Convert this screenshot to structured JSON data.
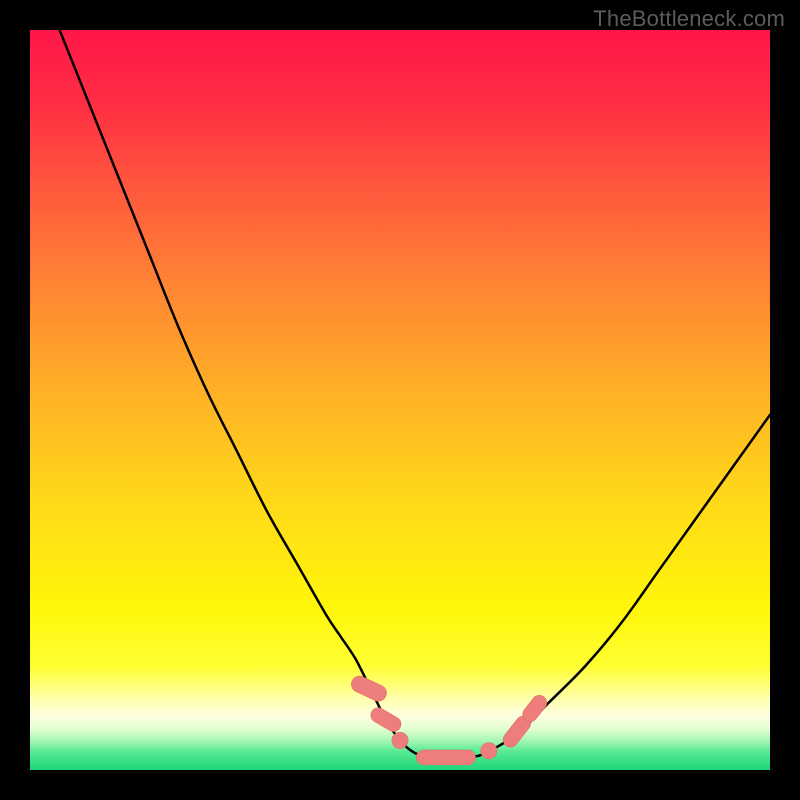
{
  "watermark": {
    "text": "TheBottleneck.com"
  },
  "layout": {
    "outer_w": 800,
    "outer_h": 800,
    "inner_x": 30,
    "inner_y": 30,
    "inner_w": 740,
    "inner_h": 740
  },
  "colors": {
    "frame": "#000000",
    "curve": "#000000",
    "marker_fill": "#ed7e7b",
    "marker_stroke": "#e56a67"
  },
  "gradient_stops": [
    {
      "offset": 0.0,
      "color": "#ff1648"
    },
    {
      "offset": 0.1,
      "color": "#ff2e44"
    },
    {
      "offset": 0.22,
      "color": "#ff5a3c"
    },
    {
      "offset": 0.35,
      "color": "#ff8633"
    },
    {
      "offset": 0.5,
      "color": "#ffb426"
    },
    {
      "offset": 0.65,
      "color": "#ffdc18"
    },
    {
      "offset": 0.78,
      "color": "#fff609"
    },
    {
      "offset": 0.86,
      "color": "#ffff33"
    },
    {
      "offset": 0.905,
      "color": "#ffffb0"
    },
    {
      "offset": 0.928,
      "color": "#fdffe2"
    },
    {
      "offset": 0.945,
      "color": "#e0ffd0"
    },
    {
      "offset": 0.96,
      "color": "#a6f8b4"
    },
    {
      "offset": 0.975,
      "color": "#57e993"
    },
    {
      "offset": 1.0,
      "color": "#1fd779"
    }
  ],
  "chart_data": {
    "type": "line",
    "title": "",
    "xlabel": "",
    "ylabel": "",
    "xlim": [
      0,
      100
    ],
    "ylim": [
      0,
      100
    ],
    "series": [
      {
        "name": "bottleneck-curve",
        "x": [
          4,
          8,
          12,
          16,
          20,
          24,
          28,
          32,
          36,
          40,
          42,
          44,
          46,
          48,
          50,
          52,
          54,
          56,
          58,
          60,
          62,
          66,
          70,
          75,
          80,
          85,
          90,
          95,
          100
        ],
        "y": [
          100,
          90,
          80,
          70,
          60,
          51,
          43,
          35,
          28,
          21,
          18,
          15,
          11,
          7,
          4,
          2.3,
          1.8,
          1.7,
          1.7,
          1.8,
          2.5,
          5,
          9,
          14,
          20,
          27,
          34,
          41,
          48
        ]
      }
    ],
    "markers": [
      {
        "shape": "pill",
        "cx": 45.8,
        "cy": 11.0,
        "rx": 1.1,
        "ry": 2.5,
        "angle": -65
      },
      {
        "shape": "pill",
        "cx": 48.1,
        "cy": 6.8,
        "rx": 1.0,
        "ry": 2.2,
        "angle": -60
      },
      {
        "shape": "circle",
        "cx": 50.0,
        "cy": 4.0,
        "rx": 1.1,
        "ry": 1.1,
        "angle": 0
      },
      {
        "shape": "pill",
        "cx": 56.2,
        "cy": 1.7,
        "rx": 4.0,
        "ry": 1.0,
        "angle": 0
      },
      {
        "shape": "circle",
        "cx": 62.0,
        "cy": 2.6,
        "rx": 1.1,
        "ry": 1.1,
        "angle": 0
      },
      {
        "shape": "pill",
        "cx": 65.8,
        "cy": 5.2,
        "rx": 1.0,
        "ry": 2.4,
        "angle": 38
      },
      {
        "shape": "pill",
        "cx": 68.2,
        "cy": 8.3,
        "rx": 1.0,
        "ry": 2.0,
        "angle": 38
      }
    ]
  }
}
